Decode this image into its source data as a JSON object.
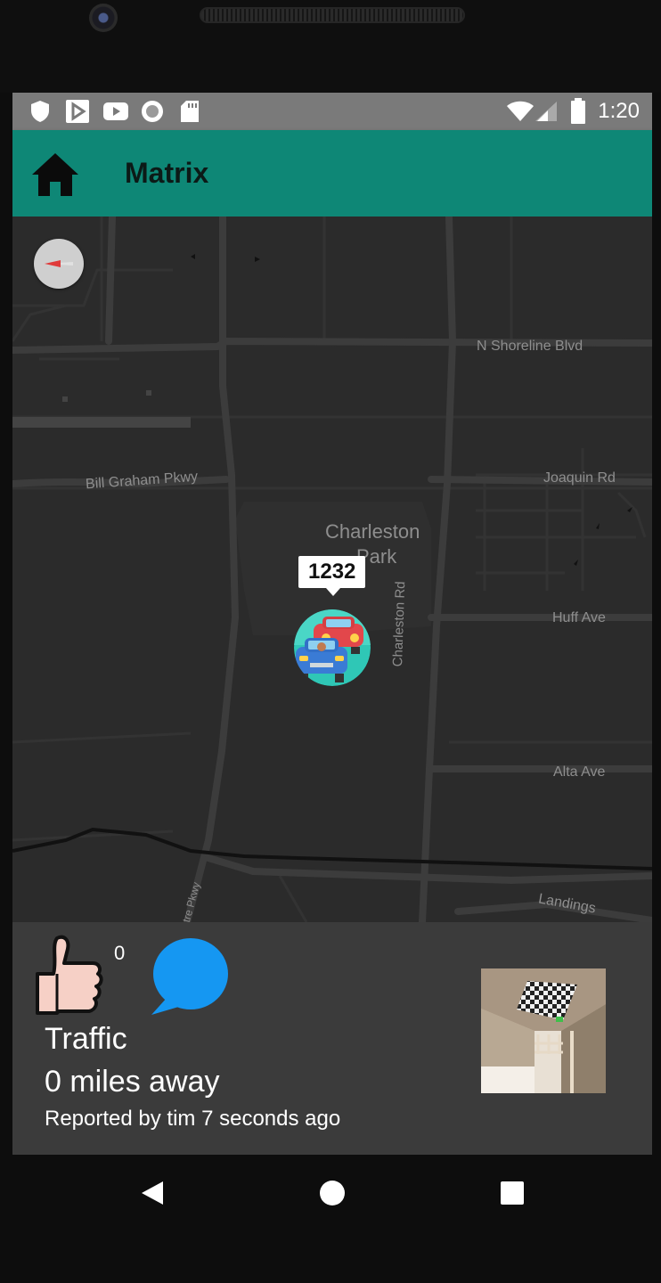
{
  "status_bar": {
    "time": "1:20",
    "icons": [
      "shield-icon",
      "play-store-icon",
      "youtube-icon",
      "record-icon",
      "sd-card-icon",
      "wifi-icon",
      "signal-icon",
      "battery-icon"
    ]
  },
  "app_bar": {
    "title": "Matrix",
    "home_icon": "home-icon",
    "color": "#0e8776"
  },
  "map": {
    "labels": {
      "n_shoreline": "N Shoreline Blvd",
      "bill_graham": "Bill Graham Pkwy",
      "joaquin": "Joaquin Rd",
      "charleston_park_1": "Charleston",
      "charleston_park_2": "Park",
      "huff": "Huff Ave",
      "charleston_rd": "Charleston Rd",
      "alta": "Alta Ave",
      "landings": "Landings",
      "centre_pkwy": "tre Pkwy"
    },
    "marker": {
      "label": "1232",
      "icon": "traffic-cars-icon"
    },
    "compass_icon": "compass-icon"
  },
  "report": {
    "like_count": "0",
    "type": "Traffic",
    "distance": "0 miles away",
    "reporter": "Reported by tim 7 seconds ago",
    "like_icon": "thumbs-up-icon",
    "comment_icon": "comment-bubble-icon",
    "comment_color": "#1597f2"
  },
  "nav_bar": {
    "buttons": [
      "back-icon",
      "home-circle-icon",
      "recents-icon"
    ]
  }
}
